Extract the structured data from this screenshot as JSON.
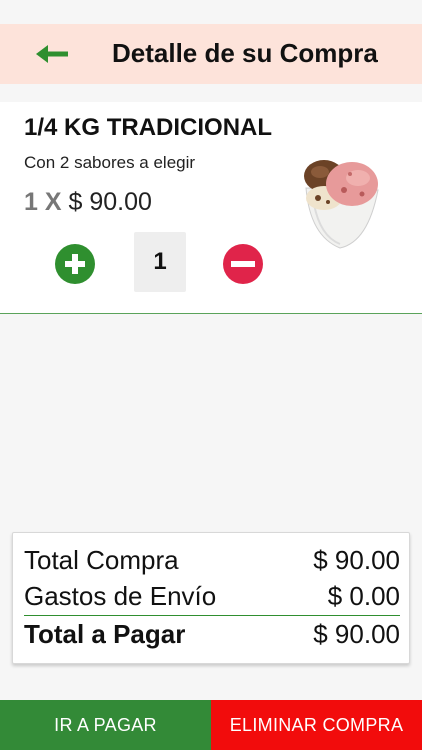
{
  "colors": {
    "header_bg": "#fde3da",
    "accent_green": "#2f8f2f",
    "danger_red": "#f20c0c",
    "minus_red": "#e0244a"
  },
  "header": {
    "title": "Detalle de su Compra",
    "back_icon": "arrow-left-icon"
  },
  "cart_items": [
    {
      "name": "1/4 KG TRADICIONAL",
      "description": "Con 2 sabores a elegir",
      "qty_prefix": "1 X",
      "price": "$ 90.00",
      "quantity": "1",
      "image_icon": "ice-cream-cup-image",
      "plus_icon": "plus-circle-icon",
      "minus_icon": "minus-circle-icon"
    }
  ],
  "totals": {
    "subtotal_label": "Total Compra",
    "subtotal_value": "$ 90.00",
    "shipping_label": "Gastos de Envío",
    "shipping_value": "$ 0.00",
    "total_label": "Total a Pagar",
    "total_value": "$ 90.00"
  },
  "actions": {
    "pay_label": "IR A PAGAR",
    "delete_label": "ELIMINAR COMPRA"
  }
}
